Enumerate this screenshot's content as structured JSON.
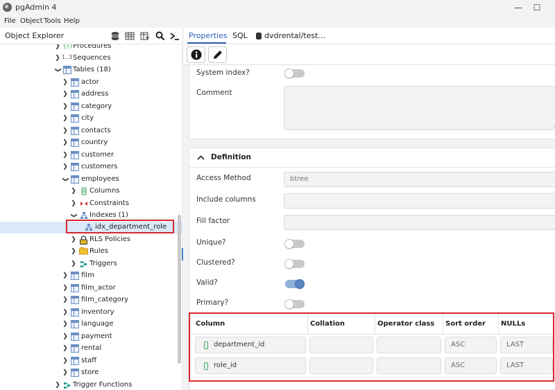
{
  "window": {
    "title": "pgAdmin 4",
    "minimize": "—",
    "maximize": "☐"
  },
  "menu": [
    "File",
    "Object",
    "Tools",
    "Help"
  ],
  "explorer": {
    "title": "Object Explorer",
    "tree": [
      {
        "label": "Procedures",
        "icon": "procedures-icon"
      },
      {
        "label": "Sequences",
        "icon": "sequences-icon",
        "prefix": "1..3"
      },
      {
        "label": "Tables (18)",
        "icon": "tables-icon"
      },
      {
        "label": "actor"
      },
      {
        "label": "address"
      },
      {
        "label": "category"
      },
      {
        "label": "city"
      },
      {
        "label": "contacts"
      },
      {
        "label": "country"
      },
      {
        "label": "customer"
      },
      {
        "label": "customers"
      },
      {
        "label": "employees"
      },
      {
        "label": "Columns"
      },
      {
        "label": "Constraints"
      },
      {
        "label": "Indexes (1)"
      },
      {
        "label": "idx_department_role"
      },
      {
        "label": "RLS Policies"
      },
      {
        "label": "Rules"
      },
      {
        "label": "Triggers"
      },
      {
        "label": "film"
      },
      {
        "label": "film_actor"
      },
      {
        "label": "film_category"
      },
      {
        "label": "inventory"
      },
      {
        "label": "language"
      },
      {
        "label": "payment"
      },
      {
        "label": "rental"
      },
      {
        "label": "staff"
      },
      {
        "label": "store"
      },
      {
        "label": "Trigger Functions"
      }
    ]
  },
  "tabs": {
    "properties": "Properties",
    "sql": "SQL",
    "query": "dvdrental/test..."
  },
  "general": {
    "system_index_label": "System index?",
    "comment_label": "Comment"
  },
  "definition": {
    "header": "Definition",
    "access_method_label": "Access Method",
    "access_method_value": "btree",
    "include_columns_label": "Include columns",
    "fill_factor_label": "Fill factor",
    "unique_label": "Unique?",
    "clustered_label": "Clustered?",
    "valid_label": "Valid?",
    "primary_label": "Primary?",
    "toggles": {
      "system_index": false,
      "unique": false,
      "clustered": false,
      "valid": true,
      "primary": false
    }
  },
  "columns_table": {
    "headers": [
      "Column",
      "Collation",
      "Operator class",
      "Sort order",
      "NULLs"
    ],
    "rows": [
      {
        "column": "department_id",
        "collation": "",
        "operator_class": "",
        "sort_order": "ASC",
        "nulls": "LAST"
      },
      {
        "column": "role_id",
        "collation": "",
        "operator_class": "",
        "sort_order": "ASC",
        "nulls": "LAST"
      }
    ]
  },
  "colors": {
    "accent": "#2a62b8",
    "highlight_box": "#d9262c",
    "selection": "#dbe8f8"
  }
}
